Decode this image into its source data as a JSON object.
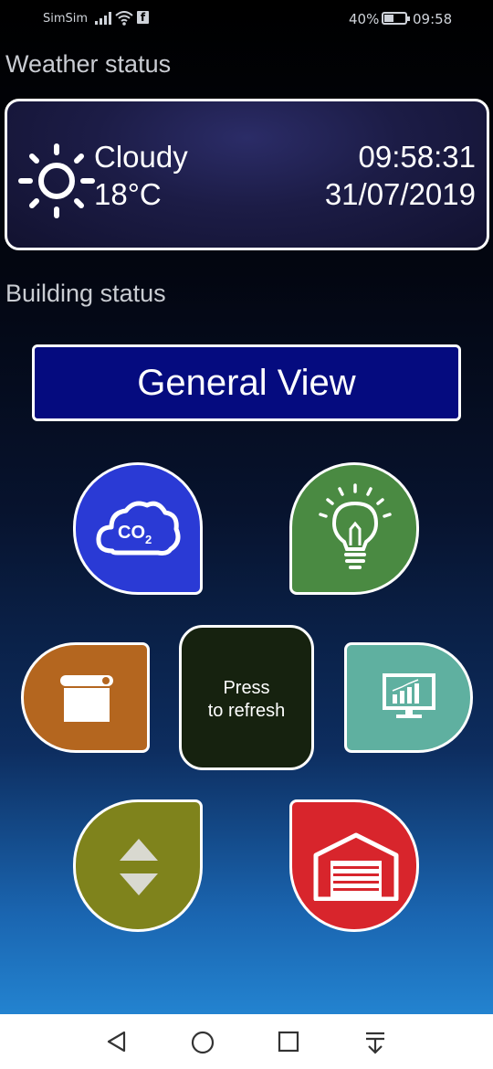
{
  "status_bar": {
    "carrier": "SimSim",
    "facebook_glyph": "f",
    "battery_percent": "40%",
    "battery_level": 0.4,
    "time": "09:58"
  },
  "weather": {
    "section_title": "Weather status",
    "condition": "Cloudy",
    "temperature": "18°C",
    "time": "09:58:31",
    "date": "31/07/2019",
    "icon": "sun-icon"
  },
  "building": {
    "section_title": "Building status",
    "general_view_label": "General View",
    "tiles": {
      "co2": {
        "icon": "co2-cloud-icon",
        "co2_label": "CO",
        "co2_subscript": "2",
        "color": "#2a3ad5"
      },
      "lighting": {
        "icon": "lightbulb-icon",
        "color": "#4a8a42"
      },
      "blinds": {
        "icon": "blind-icon",
        "color": "#b4661f"
      },
      "refresh": {
        "line1": "Press",
        "line2": "to refresh",
        "color": "#16220f"
      },
      "monitoring": {
        "icon": "monitor-chart-icon",
        "color": "#5fb0a0"
      },
      "elevator": {
        "icon": "elevator-arrows-icon",
        "color": "#7f831c"
      },
      "garage": {
        "icon": "garage-door-icon",
        "color": "#d8252c"
      }
    }
  },
  "nav_bar": {
    "buttons": [
      "back-icon",
      "home-icon",
      "recents-icon",
      "notifications-pull-icon"
    ]
  }
}
